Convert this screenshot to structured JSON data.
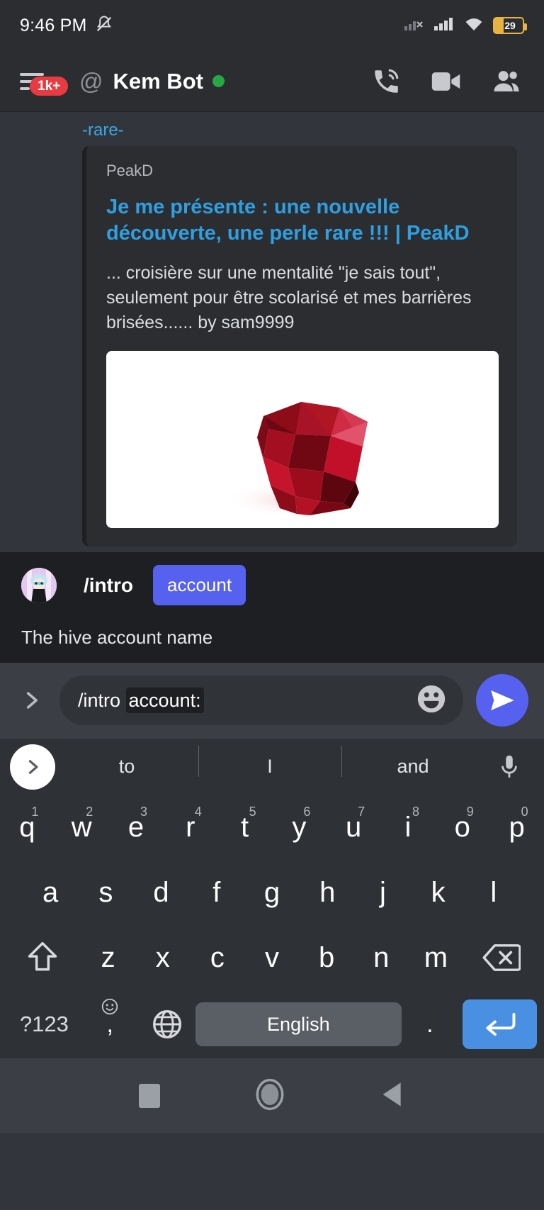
{
  "statusbar": {
    "time": "9:46 PM",
    "mute_icon": "bell-mute-icon",
    "signal1_icon": "signal-no-sim-icon",
    "signal2_icon": "signal-bars-icon",
    "wifi_icon": "wifi-icon",
    "battery_level": "29"
  },
  "header": {
    "back_icon": "back-arrow-icon",
    "unread_badge": "1k+",
    "at_symbol": "@",
    "title": "Kem Bot",
    "status_dot_color": "#27a844",
    "call_icon": "phone-call-icon",
    "video_icon": "video-camera-icon",
    "members_icon": "people-icon"
  },
  "chat": {
    "message_text": "-rare-",
    "embed": {
      "provider": "PeakD",
      "title": "Je me présente : une nouvelle découverte, une perle rare !!! | PeakD",
      "description": "... croisière sur une mentalité \"je sais tout\", seulement pour être scolarisé et mes barrières brisées...... by sam9999",
      "image_alt": "ruby-gemstone-image"
    }
  },
  "command_panel": {
    "avatar_name": "bot-avatar",
    "slash": "/",
    "command_name": "intro",
    "option_chip": "account",
    "chip_color": "#5661f0",
    "description": "The hive account name"
  },
  "composer": {
    "expand_icon": "chevron-right-icon",
    "input_prefix": "/intro ",
    "input_highlight": "account:",
    "emoji_icon": "emoji-smile-icon",
    "send_icon": "send-icon",
    "send_color": "#5661f0"
  },
  "keyboard": {
    "expand_icon": "chevron-right-icon",
    "suggestions": [
      "to",
      "I",
      "and"
    ],
    "mic_icon": "microphone-icon",
    "row1": [
      {
        "key": "q",
        "num": "1"
      },
      {
        "key": "w",
        "num": "2"
      },
      {
        "key": "e",
        "num": "3"
      },
      {
        "key": "r",
        "num": "4"
      },
      {
        "key": "t",
        "num": "5"
      },
      {
        "key": "y",
        "num": "6"
      },
      {
        "key": "u",
        "num": "7"
      },
      {
        "key": "i",
        "num": "8"
      },
      {
        "key": "o",
        "num": "9"
      },
      {
        "key": "p",
        "num": "0"
      }
    ],
    "row2": [
      "a",
      "s",
      "d",
      "f",
      "g",
      "h",
      "j",
      "k",
      "l"
    ],
    "row3": {
      "shift_icon": "shift-up-icon",
      "keys": [
        "z",
        "x",
        "c",
        "v",
        "b",
        "n",
        "m"
      ],
      "backspace_icon": "backspace-icon"
    },
    "row4": {
      "symbols": "?123",
      "comma": ",",
      "emoji_icon": "emoji-outline-icon",
      "globe_icon": "globe-language-icon",
      "space_label": "English",
      "period": ".",
      "enter_icon": "enter-return-icon",
      "enter_color": "#4a90e2"
    }
  },
  "navbar": {
    "recents_icon": "square-recents-icon",
    "home_icon": "circle-home-icon",
    "back_icon": "triangle-back-icon"
  }
}
